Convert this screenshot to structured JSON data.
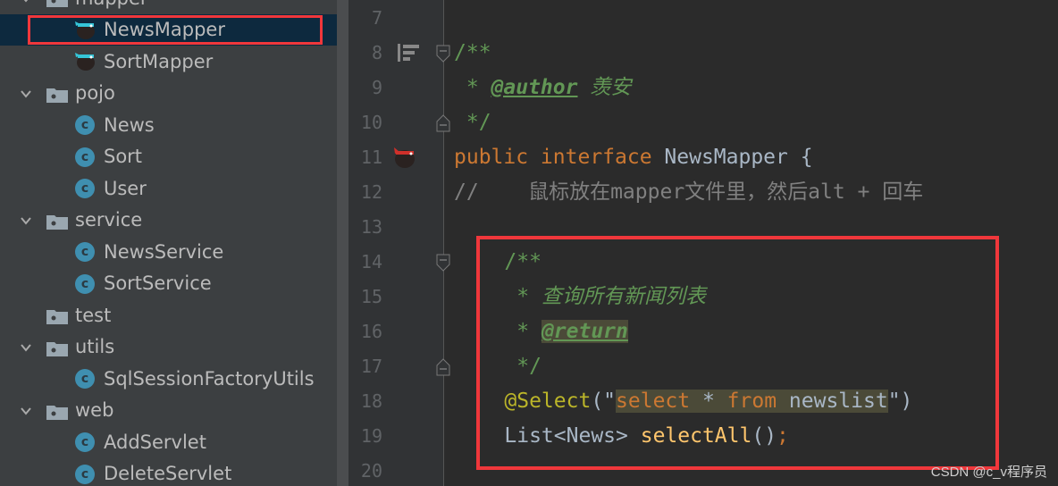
{
  "project_tree": [
    {
      "label": "mapper",
      "type": "folder",
      "level": 0,
      "expanded": true
    },
    {
      "label": "NewsMapper",
      "type": "mapper",
      "level": 1,
      "selected": true
    },
    {
      "label": "SortMapper",
      "type": "mapper",
      "level": 1
    },
    {
      "label": "pojo",
      "type": "folder",
      "level": 0,
      "expanded": true
    },
    {
      "label": "News",
      "type": "class",
      "level": 1
    },
    {
      "label": "Sort",
      "type": "class",
      "level": 1
    },
    {
      "label": "User",
      "type": "class",
      "level": 1
    },
    {
      "label": "service",
      "type": "folder",
      "level": 0,
      "expanded": true
    },
    {
      "label": "NewsService",
      "type": "class",
      "level": 1
    },
    {
      "label": "SortService",
      "type": "class",
      "level": 1
    },
    {
      "label": "test",
      "type": "folder",
      "level": 0,
      "expanded": false
    },
    {
      "label": "utils",
      "type": "folder",
      "level": 0,
      "expanded": true
    },
    {
      "label": "SqlSessionFactoryUtils",
      "type": "class",
      "level": 1
    },
    {
      "label": "web",
      "type": "folder",
      "level": 0,
      "expanded": true
    },
    {
      "label": "AddServlet",
      "type": "class",
      "level": 1
    },
    {
      "label": "DeleteServlet",
      "type": "class",
      "level": 1
    }
  ],
  "editor": {
    "lines": [
      {
        "n": "7",
        "indent": 0,
        "tokens": []
      },
      {
        "n": "8",
        "indent": 0,
        "tokens": [
          {
            "c": "cmn",
            "t": "/**"
          }
        ],
        "gutter": "structure-icon",
        "fold": "open"
      },
      {
        "n": "9",
        "indent": 0,
        "tokens": [
          {
            "c": "cmn",
            "t": " * "
          },
          {
            "c": "tag",
            "t": "@author"
          },
          {
            "c": "cm",
            "t": " 羡安"
          }
        ]
      },
      {
        "n": "10",
        "indent": 0,
        "tokens": [
          {
            "c": "cmn",
            "t": " */"
          }
        ],
        "fold": "close"
      },
      {
        "n": "11",
        "indent": 0,
        "tokens": [
          {
            "c": "kw",
            "t": "public interface "
          },
          {
            "c": "id",
            "t": "NewsMapper {"
          }
        ],
        "gutter": "mybatis-icon"
      },
      {
        "n": "12",
        "indent": 0,
        "tokens": [
          {
            "c": "lc",
            "t": "//    鼠标放在mapper文件里，然后alt + 回车"
          }
        ]
      },
      {
        "n": "13",
        "indent": 0,
        "tokens": []
      },
      {
        "n": "14",
        "indent": 4,
        "tokens": [
          {
            "c": "cmn",
            "t": "/**"
          }
        ],
        "fold": "open"
      },
      {
        "n": "15",
        "indent": 4,
        "tokens": [
          {
            "c": "cmn",
            "t": " * "
          },
          {
            "c": "cm",
            "t": "查询所有新闻列表"
          }
        ]
      },
      {
        "n": "16",
        "indent": 4,
        "tokens": [
          {
            "c": "cmn",
            "t": " * "
          },
          {
            "c": "tag hl-bg",
            "t": "@return"
          }
        ]
      },
      {
        "n": "17",
        "indent": 4,
        "tokens": [
          {
            "c": "cmn",
            "t": " */"
          }
        ],
        "fold": "close"
      },
      {
        "n": "18",
        "indent": 4,
        "tokens": [
          {
            "c": "ann",
            "t": "@Select"
          },
          {
            "c": "id",
            "t": "(\""
          },
          {
            "c": "kw hl-bg",
            "t": "select "
          },
          {
            "c": "id hl-bg",
            "t": "* "
          },
          {
            "c": "kw hl-bg",
            "t": "from "
          },
          {
            "c": "id hl-bg",
            "t": "newslist"
          },
          {
            "c": "id",
            "t": "\")"
          }
        ]
      },
      {
        "n": "19",
        "indent": 4,
        "tokens": [
          {
            "c": "id",
            "t": "List<News> "
          },
          {
            "c": "fn",
            "t": "selectAll"
          },
          {
            "c": "id",
            "t": "()"
          },
          {
            "c": "kw",
            "t": ";"
          }
        ]
      },
      {
        "n": "20",
        "indent": 0,
        "tokens": []
      }
    ]
  },
  "watermark": "CSDN @c_v程序员",
  "colors": {
    "highlight_box": "#f0373b",
    "editor_bg": "#2b2b2b",
    "sidebar_bg": "#3c3f41"
  }
}
